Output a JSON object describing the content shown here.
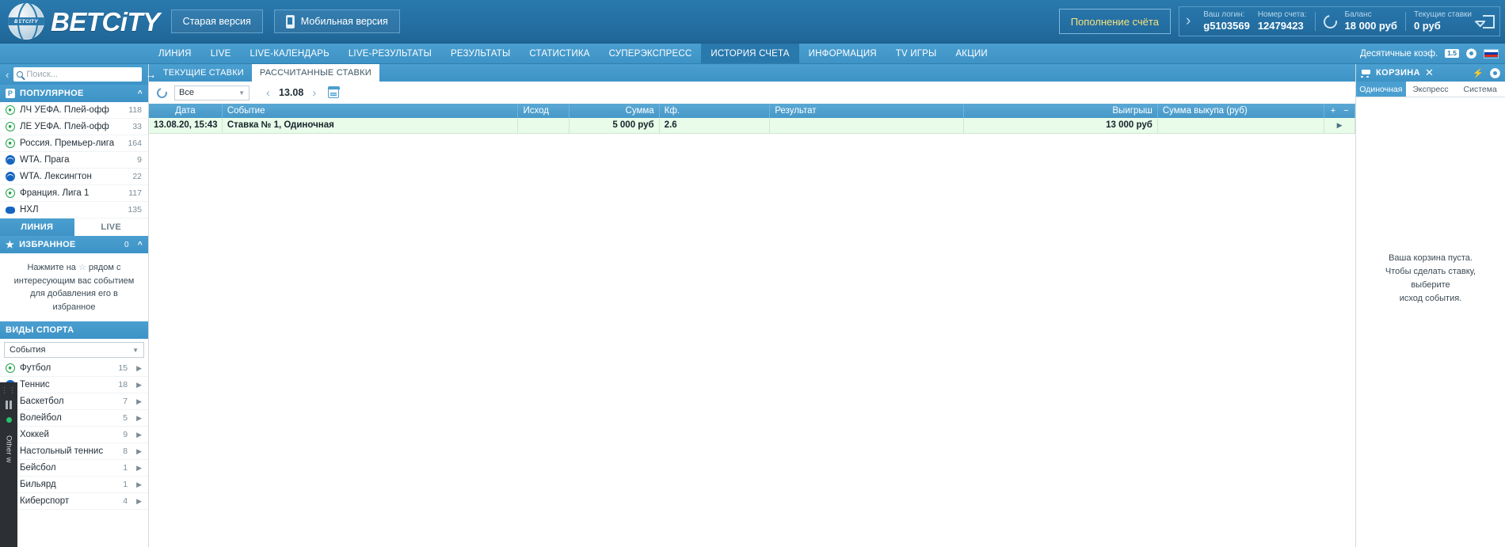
{
  "header": {
    "brand": "BETCiTY",
    "logo_badge": "BETCITY",
    "old_version_label": "Старая версия",
    "mobile_version_label": "Мобильная версия",
    "replenish_label": "Пополнение счёта",
    "account": {
      "login_label": "Ваш логин:",
      "login_value": "g5103569",
      "account_label": "Номер счета:",
      "account_value": "12479423",
      "balance_label": "Баланс",
      "balance_value": "18 000 руб",
      "current_bets_label": "Текущие ставки",
      "current_bets_value": "0 руб"
    }
  },
  "nav": {
    "items": [
      {
        "label": "ЛИНИЯ",
        "active": false
      },
      {
        "label": "LIVE",
        "active": false
      },
      {
        "label": "LIVE-КАЛЕНДАРЬ",
        "active": false
      },
      {
        "label": "LIVE-РЕЗУЛЬТАТЫ",
        "active": false
      },
      {
        "label": "РЕЗУЛЬТАТЫ",
        "active": false
      },
      {
        "label": "СТАТИСТИКА",
        "active": false
      },
      {
        "label": "СУПЕРЭКСПРЕСС",
        "active": false
      },
      {
        "label": "ИСТОРИЯ СЧЕТА",
        "active": true
      },
      {
        "label": "ИНФОРМАЦИЯ",
        "active": false
      },
      {
        "label": "TV ИГРЫ",
        "active": false
      },
      {
        "label": "АКЦИИ",
        "active": false
      }
    ],
    "coef_label": "Десятичные коэф.",
    "coef_badge": "1.5"
  },
  "sidebar": {
    "search_placeholder": "Поиск...",
    "popular": {
      "badge": "Р",
      "title": "ПОПУЛЯРНОЕ",
      "items": [
        {
          "label": "ЛЧ УЕФА. Плей-офф",
          "count": "118",
          "icon": "football-icon"
        },
        {
          "label": "ЛЕ УЕФА. Плей-офф",
          "count": "33",
          "icon": "football-icon"
        },
        {
          "label": "Россия. Премьер-лига",
          "count": "164",
          "icon": "football-icon"
        },
        {
          "label": "WTA. Прага",
          "count": "9",
          "icon": "tennis-icon"
        },
        {
          "label": "WTA. Лексингтон",
          "count": "22",
          "icon": "tennis-icon"
        },
        {
          "label": "Франция. Лига 1",
          "count": "117",
          "icon": "football-icon"
        },
        {
          "label": "НХЛ",
          "count": "135",
          "icon": "hockey-icon"
        }
      ]
    },
    "mode_tabs": [
      {
        "label": "ЛИНИЯ",
        "active": true
      },
      {
        "label": "LIVE",
        "active": false
      }
    ],
    "favorites": {
      "title": "ИЗБРАННОЕ",
      "count": "0",
      "hint_before": "Нажмите на",
      "hint_star": "☆",
      "hint_after": "рядом с интересующим вас событием для добавления его в избранное"
    },
    "sports": {
      "title": "ВИДЫ СПОРТА",
      "select_value": "События",
      "items": [
        {
          "label": "Футбол",
          "count": "15",
          "icon": "football-icon"
        },
        {
          "label": "Теннис",
          "count": "18",
          "icon": "tennis-icon"
        },
        {
          "label": "Баскетбол",
          "count": "7",
          "icon": "basketball-icon"
        },
        {
          "label": "Волейбол",
          "count": "5",
          "icon": "volleyball-icon"
        },
        {
          "label": "Хоккей",
          "count": "9",
          "icon": "hockey-icon"
        },
        {
          "label": "Настольный теннис",
          "count": "8",
          "icon": "table-tennis-icon"
        },
        {
          "label": "Бейсбол",
          "count": "1",
          "icon": "baseball-icon"
        },
        {
          "label": "Бильярд",
          "count": "1",
          "icon": "billiards-icon"
        },
        {
          "label": "Киберспорт",
          "count": "4",
          "icon": "esports-icon"
        }
      ]
    },
    "left_widget_text": "Other w"
  },
  "main": {
    "tabs": [
      {
        "label": "ТЕКУЩИЕ СТАВКИ",
        "active": false
      },
      {
        "label": "РАССЧИТАННЫЕ СТАВКИ",
        "active": true
      }
    ],
    "filter_value": "Все",
    "date_value": "13.08",
    "table": {
      "columns": [
        "Дата",
        "Событие",
        "Исход",
        "Сумма",
        "Кф.",
        "Результат",
        "Выигрыш",
        "Сумма выкупа (руб)"
      ],
      "plus_label": "+",
      "minus_label": "−",
      "rows": [
        {
          "date": "13.08.20, 15:43",
          "event": "Ставка № 1, Одиночная",
          "outcome": "",
          "amount": "5 000 руб",
          "coef": "2.6",
          "result": "",
          "win": "13 000 руб",
          "cashout": "",
          "expand": "▶"
        }
      ]
    }
  },
  "basket": {
    "title": "КОРЗИНА",
    "close_label": "✕",
    "tabs": [
      {
        "label": "Одиночная",
        "active": true
      },
      {
        "label": "Экспресс",
        "active": false
      },
      {
        "label": "Система",
        "active": false
      }
    ],
    "empty_line1": "Ваша корзина пуста.",
    "empty_line2": "Чтобы сделать ставку, выберите",
    "empty_line3": "исход события."
  },
  "colors": {
    "brand_blue": "#2a79ad",
    "nav_blue": "#4a9fd0",
    "row_green": "#e9fbe9",
    "accent_yellow": "#f6e27a"
  }
}
